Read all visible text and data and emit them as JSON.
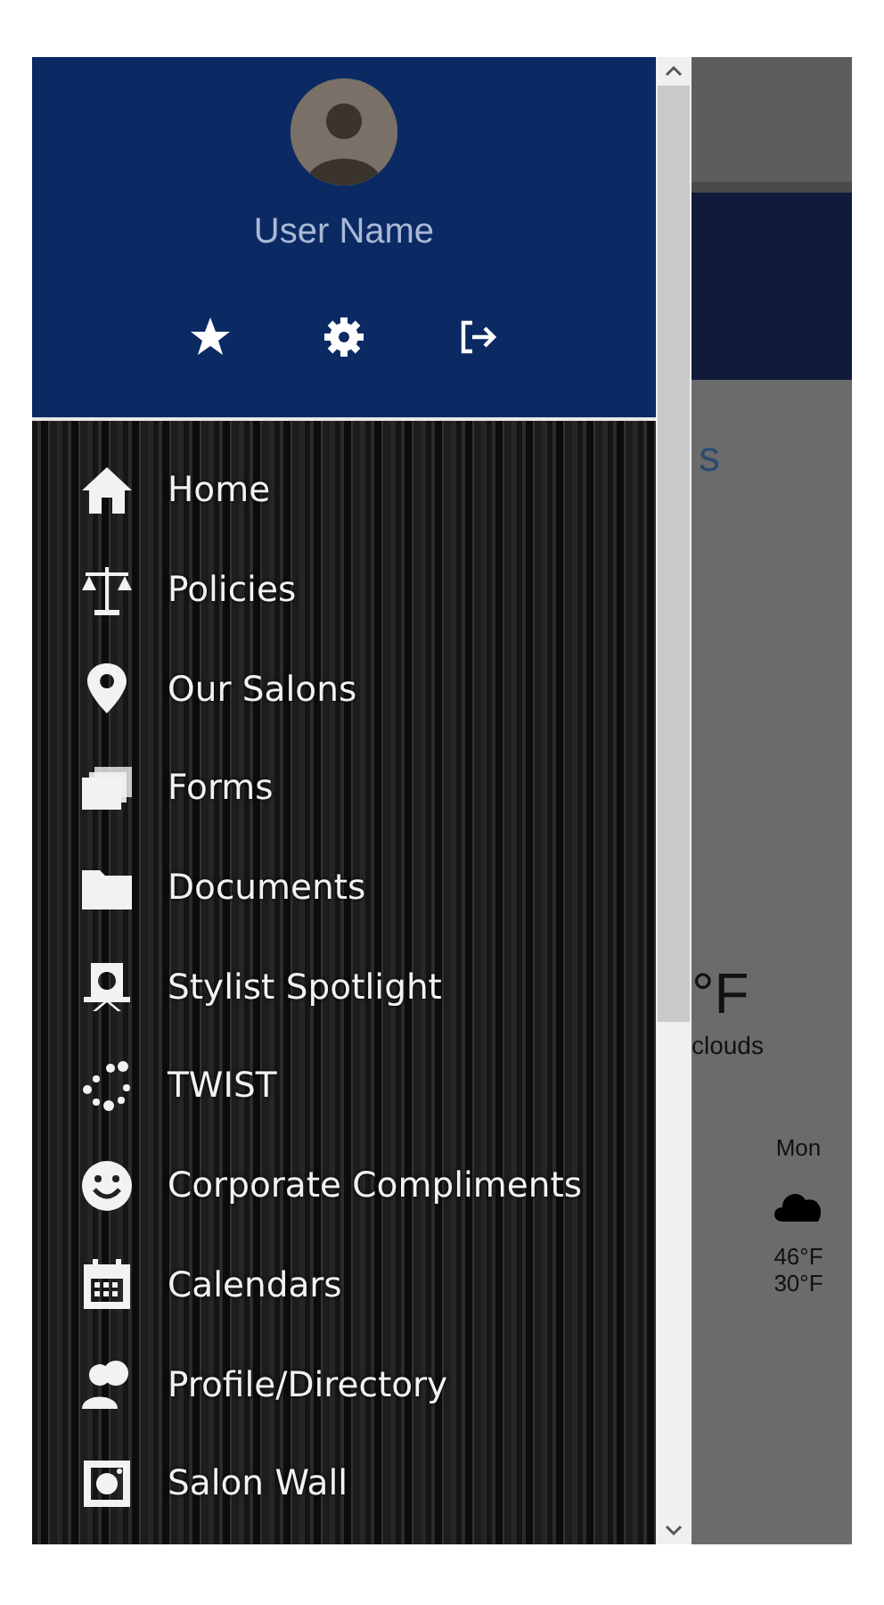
{
  "header": {
    "user_name": "User Name"
  },
  "menu": [
    {
      "label": "Home"
    },
    {
      "label": "Policies"
    },
    {
      "label": "Our Salons"
    },
    {
      "label": "Forms"
    },
    {
      "label": "Documents"
    },
    {
      "label": "Stylist Spotlight"
    },
    {
      "label": "TWIST"
    },
    {
      "label": "Corporate Compliments"
    },
    {
      "label": "Calendars"
    },
    {
      "label": "Profile/Directory"
    },
    {
      "label": "Salon Wall"
    }
  ],
  "background_page": {
    "heading_fragment": "s",
    "temperature": "°F",
    "condition": "clouds",
    "forecast": {
      "day": "Mon",
      "high": "46°F",
      "low": "30°F"
    }
  }
}
